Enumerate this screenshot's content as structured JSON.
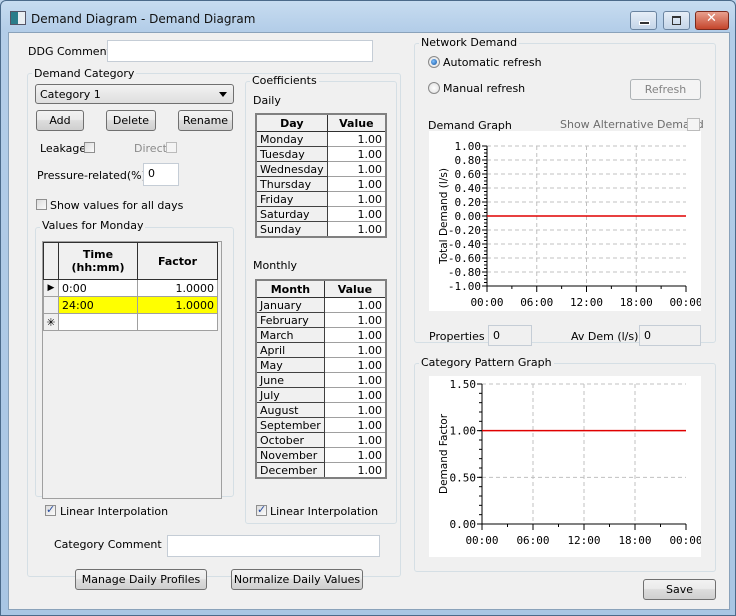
{
  "window": {
    "title": "Demand Diagram - Demand Diagram",
    "controls": [
      "minimize",
      "maximize",
      "close"
    ]
  },
  "ddg_comment": {
    "label": "DDG Comment",
    "value": ""
  },
  "demand_category": {
    "label": "Demand Category",
    "selected": "Category 1",
    "buttons": {
      "add": "Add",
      "delete": "Delete",
      "rename": "Rename"
    },
    "leakage": {
      "label": "Leakage",
      "checked": false
    },
    "direct": {
      "label": "Direct",
      "checked": false,
      "enabled": false
    },
    "pressure_related": {
      "label": "Pressure-related(%)",
      "value": "0"
    },
    "show_all_days": {
      "label": "Show values for all days",
      "checked": false
    },
    "values_group": {
      "label": "Values for Monday",
      "columns": [
        "Time\n(hh:mm)",
        "Factor"
      ],
      "col_time": "Time",
      "col_time_sub": "(hh:mm)",
      "col_factor": "Factor",
      "rows": [
        {
          "indicator": "current-row",
          "time": "0:00",
          "factor": "1.0000",
          "highlight": false
        },
        {
          "indicator": "",
          "time": "24:00",
          "factor": "1.0000",
          "highlight": true
        },
        {
          "indicator": "new-row",
          "time": "",
          "factor": "",
          "highlight": false
        }
      ],
      "linear_interpolation": {
        "label": "Linear Interpolation",
        "checked": true
      }
    },
    "category_comment": {
      "label": "Category Comment",
      "value": ""
    },
    "manage_daily_profiles": "Manage Daily Profiles",
    "normalize_daily_values": "Normalize Daily Values"
  },
  "coefficients": {
    "label": "Coefficients",
    "daily": {
      "label": "Daily",
      "columns": [
        "Day",
        "Value"
      ],
      "rows": [
        {
          "name": "Monday",
          "value": "1.00"
        },
        {
          "name": "Tuesday",
          "value": "1.00"
        },
        {
          "name": "Wednesday",
          "value": "1.00"
        },
        {
          "name": "Thursday",
          "value": "1.00"
        },
        {
          "name": "Friday",
          "value": "1.00"
        },
        {
          "name": "Saturday",
          "value": "1.00"
        },
        {
          "name": "Sunday",
          "value": "1.00"
        }
      ]
    },
    "monthly": {
      "label": "Monthly",
      "columns": [
        "Month",
        "Value"
      ],
      "rows": [
        {
          "name": "January",
          "value": "1.00"
        },
        {
          "name": "February",
          "value": "1.00"
        },
        {
          "name": "March",
          "value": "1.00"
        },
        {
          "name": "April",
          "value": "1.00"
        },
        {
          "name": "May",
          "value": "1.00"
        },
        {
          "name": "June",
          "value": "1.00"
        },
        {
          "name": "July",
          "value": "1.00"
        },
        {
          "name": "August",
          "value": "1.00"
        },
        {
          "name": "September",
          "value": "1.00"
        },
        {
          "name": "October",
          "value": "1.00"
        },
        {
          "name": "November",
          "value": "1.00"
        },
        {
          "name": "December",
          "value": "1.00"
        }
      ]
    },
    "linear_interpolation": {
      "label": "Linear Interpolation",
      "checked": true
    }
  },
  "network_demand": {
    "label": "Network Demand",
    "automatic_refresh": {
      "label": "Automatic refresh",
      "selected": true
    },
    "manual_refresh": {
      "label": "Manual refresh",
      "selected": false
    },
    "refresh_button": "Refresh",
    "demand_graph_label": "Demand Graph",
    "show_alternative_demand": {
      "label": "Show Alternative Demand",
      "checked": false,
      "enabled": false
    },
    "properties": {
      "label": "Properties",
      "value": "0"
    },
    "av_dem": {
      "label": "Av Dem (l/s)",
      "value": "0"
    }
  },
  "category_pattern_graph": {
    "label": "Category Pattern Graph"
  },
  "save_button": "Save",
  "colors": {
    "series": "#e00000",
    "highlight_row": "#ffff00",
    "grid": "#c0c0c0"
  },
  "chart_data": [
    {
      "type": "line",
      "title": "Demand Graph",
      "xlabel": "",
      "ylabel": "Total Demand (l/s)",
      "x_ticks": [
        "00:00",
        "06:00",
        "12:00",
        "18:00",
        "00:00"
      ],
      "y_ticks": [
        "1.00",
        "0.80",
        "0.60",
        "0.40",
        "0.20",
        "0.00",
        "-0.20",
        "-0.40",
        "-0.60",
        "-0.80",
        "-1.00"
      ],
      "ylim": [
        -1.0,
        1.0
      ],
      "xlim_hours": [
        0,
        24
      ],
      "grid": true,
      "series": [
        {
          "name": "Total Demand",
          "x": [
            0,
            24
          ],
          "values": [
            0.0,
            0.0
          ],
          "color": "#e00000"
        }
      ]
    },
    {
      "type": "line",
      "title": "Category Pattern Graph",
      "xlabel": "",
      "ylabel": "Demand Factor",
      "x_ticks": [
        "00:00",
        "06:00",
        "12:00",
        "18:00",
        "00:00"
      ],
      "y_ticks": [
        "1.50",
        "1.00",
        "0.50",
        "0.00"
      ],
      "ylim": [
        0.0,
        1.5
      ],
      "xlim_hours": [
        0,
        24
      ],
      "grid": true,
      "series": [
        {
          "name": "Demand Factor",
          "x": [
            0,
            24
          ],
          "values": [
            1.0,
            1.0
          ],
          "color": "#e00000"
        }
      ]
    }
  ]
}
